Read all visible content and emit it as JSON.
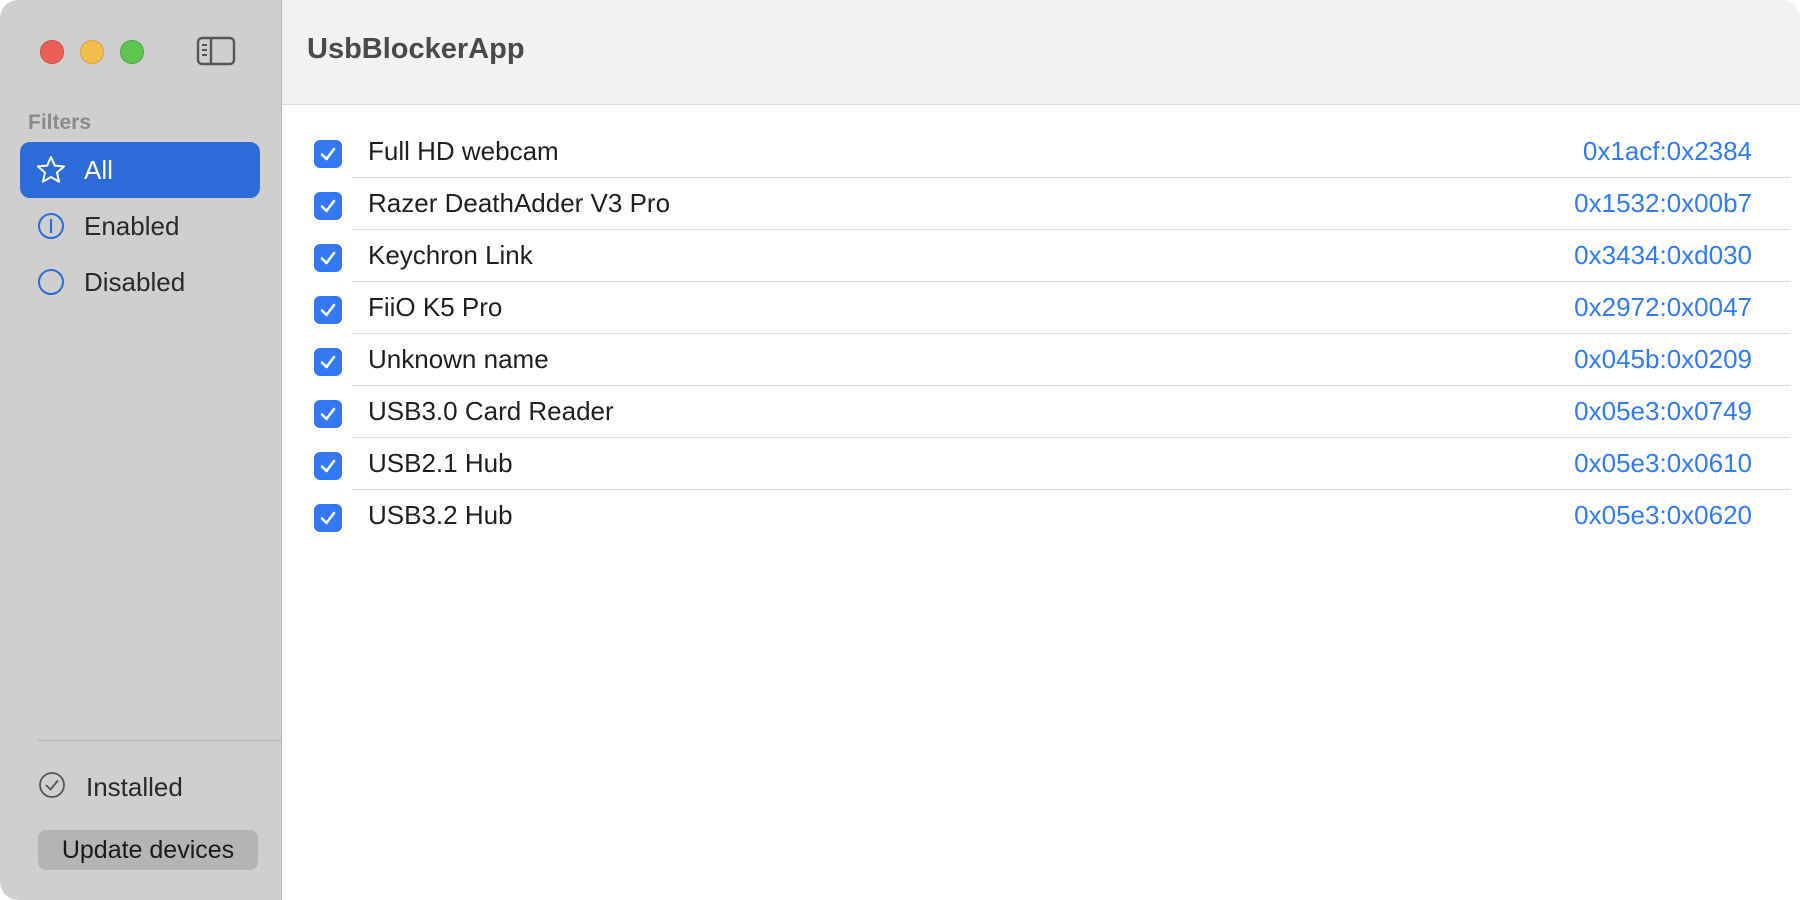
{
  "window": {
    "controls": [
      "close",
      "minimize",
      "zoom"
    ]
  },
  "sidebar": {
    "toggle_icon": "sidebar-left-icon",
    "filters_heading": "Filters",
    "items": [
      {
        "label": "All",
        "icon": "star-icon",
        "selected": true
      },
      {
        "label": "Enabled",
        "icon": "circle-line-icon",
        "selected": false
      },
      {
        "label": "Disabled",
        "icon": "circle-icon",
        "selected": false
      }
    ],
    "status": {
      "label": "Installed",
      "icon": "checkmark-circle-icon"
    },
    "update_button_label": "Update devices"
  },
  "main": {
    "title": "UsbBlockerApp",
    "devices": [
      {
        "name": "Full HD webcam",
        "id": "0x1acf:0x2384",
        "checked": true
      },
      {
        "name": "Razer DeathAdder V3 Pro",
        "id": "0x1532:0x00b7",
        "checked": true
      },
      {
        "name": "Keychron Link",
        "id": "0x3434:0xd030",
        "checked": true
      },
      {
        "name": "FiiO K5 Pro",
        "id": "0x2972:0x0047",
        "checked": true
      },
      {
        "name": "Unknown name",
        "id": "0x045b:0x0209",
        "checked": true
      },
      {
        "name": "USB3.0 Card Reader",
        "id": "0x05e3:0x0749",
        "checked": true
      },
      {
        "name": "USB2.1 Hub",
        "id": "0x05e3:0x0610",
        "checked": true
      },
      {
        "name": "USB3.2 Hub",
        "id": "0x05e3:0x0620",
        "checked": true
      }
    ]
  },
  "colors": {
    "accent": "#2d6bd8",
    "checkbox": "#3478f6",
    "device_id_text": "#2f7bf0",
    "sidebar_bg": "#cfcfcf"
  }
}
